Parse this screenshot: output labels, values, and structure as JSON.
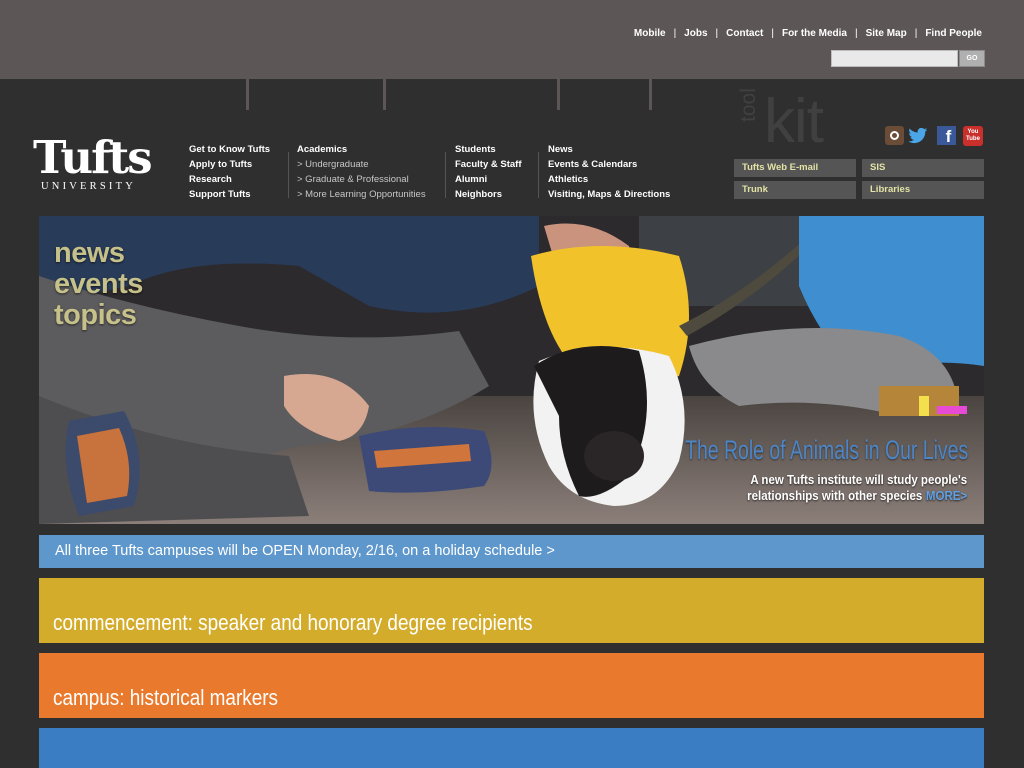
{
  "utility_nav": {
    "items": [
      "Mobile",
      "Jobs",
      "Contact",
      "For the Media",
      "Site Map",
      "Find People"
    ],
    "separator": "|"
  },
  "search": {
    "button_label": "GO",
    "value": ""
  },
  "logo": {
    "name": "Tufts",
    "subtitle": "UNIVERSITY"
  },
  "main_nav": {
    "col1": [
      "Get to Know Tufts",
      "Apply to Tufts",
      "Research",
      "Support Tufts"
    ],
    "col2": {
      "heading": "Academics",
      "items": [
        "> Undergraduate",
        "> Graduate & Professional",
        "> More Learning Opportunities"
      ]
    },
    "col3": [
      "Students",
      "Faculty & Staff",
      "Alumni",
      "Neighbors"
    ],
    "col4": [
      "News",
      "Events & Calendars",
      "Athletics",
      "Visiting, Maps & Directions"
    ]
  },
  "toolkit": {
    "title_small": "tool",
    "title_large": "kit",
    "links": [
      "Tufts Web E-mail",
      "SIS",
      "Trunk",
      "Libraries"
    ],
    "social": [
      "instagram-icon",
      "twitter-icon",
      "facebook-icon",
      "youtube-icon"
    ],
    "youtube_text": [
      "You",
      "Tube"
    ]
  },
  "hero": {
    "nav": [
      "news",
      "events",
      "topics"
    ],
    "headline": "The Role of Animals in Our Lives",
    "caption_line1": "A new Tufts institute will study people's",
    "caption_line2": "relationships with other species",
    "more": "MORE>"
  },
  "alert": {
    "text": "All three Tufts campuses will be OPEN Monday, 2/16, on a holiday schedule  >"
  },
  "features": [
    {
      "text": "commencement: speaker and honorary degree recipients",
      "color": "#d4ac2b"
    },
    {
      "text": "campus: historical markers",
      "color": "#e97a2d"
    },
    {
      "text": "",
      "color": "#3b7dc2"
    }
  ],
  "colors": {
    "topbar": "#5d5657",
    "page_bg": "#2f2f2f",
    "alert": "#5e97cc",
    "toolkit_label": "#e3e3a6"
  }
}
